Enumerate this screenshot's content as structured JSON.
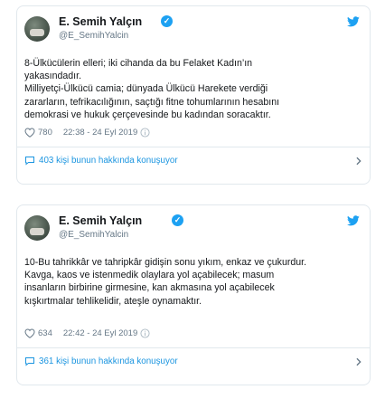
{
  "tweets": [
    {
      "name": "E. Semih Yalçın",
      "handle": "@E_SemihYalcin",
      "lines": [
        "8-Ülkücülerin elleri; iki cihanda da bu Felaket Kadın’ın",
        "yakasındadır.",
        "Milliyetçi-Ülkücü camia; dünyada Ülkücü Harekete verdiği",
        "zararların, tefrikacılığının, saçtığı fitne tohumlarının hesabını",
        "demokrasi ve hukuk çerçevesinde bu kadından soracaktır."
      ],
      "likes": "780",
      "timestamp": "22:38 - 24 Eyl 2019",
      "conversation": "403 kişi bunun hakkında konuşuyor"
    },
    {
      "name": "E. Semih Yalçın",
      "handle": "@E_SemihYalcin",
      "lines": [
        "10-Bu tahrikkâr ve tahripkâr gidişin sonu yıkım, enkaz ve çukurdur.",
        "Kavga, kaos ve istenmedik olaylara yol açabilecek; masum",
        "insanların birbirine girmesine, kan akmasına yol açabilecek",
        "kışkırtmalar tehlikelidir, ateşle oynamaktır."
      ],
      "likes": "634",
      "timestamp": "22:42 - 24 Eyl 2019",
      "conversation": "361 kişi bunun hakkında konuşuyor"
    }
  ],
  "colors": {
    "accent": "#1da1f2",
    "link": "#1b95e0",
    "muted": "#657786",
    "border": "#e1e8ed"
  },
  "icons": [
    "avatar",
    "verified-badge-icon",
    "twitter-bird-icon",
    "heart-icon",
    "info-icon",
    "speech-bubble-icon",
    "chevron-right-icon"
  ]
}
